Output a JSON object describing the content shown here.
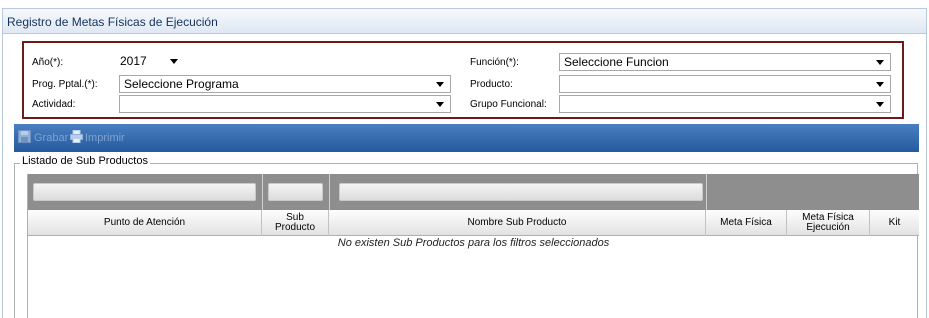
{
  "window": {
    "title": "Registro de Metas Físicas de Ejecución"
  },
  "filters": {
    "anio": {
      "label": "Año(*):",
      "value": "2017"
    },
    "prog": {
      "label": "Prog. Pptal.(*):",
      "value": "Seleccione Programa"
    },
    "actividad": {
      "label": "Actividad:",
      "value": ""
    },
    "funcion": {
      "label": "Función(*):",
      "value": "Seleccione Funcion"
    },
    "producto": {
      "label": "Producto:",
      "value": ""
    },
    "grupo": {
      "label": "Grupo Funcional:",
      "value": ""
    }
  },
  "toolbar": {
    "save_label": "Grabar",
    "print_label": "Imprimir"
  },
  "section": {
    "title": "Listado de Sub Productos"
  },
  "table": {
    "columns": {
      "punto": "Punto de Atención",
      "sub_1": "Sub",
      "sub_2": "Producto",
      "nombre": "Nombre Sub Producto",
      "meta": "Meta Física",
      "meta_ej_1": "Meta Física",
      "meta_ej_2": "Ejecución",
      "kit": "Kit"
    },
    "empty_message": "No existen Sub Productos para los filtros seleccionados"
  },
  "colors": {
    "toolbar": "#2f66a8",
    "filter_border": "#6d1a1a",
    "grid_filter_row": "#8e8e8e"
  }
}
